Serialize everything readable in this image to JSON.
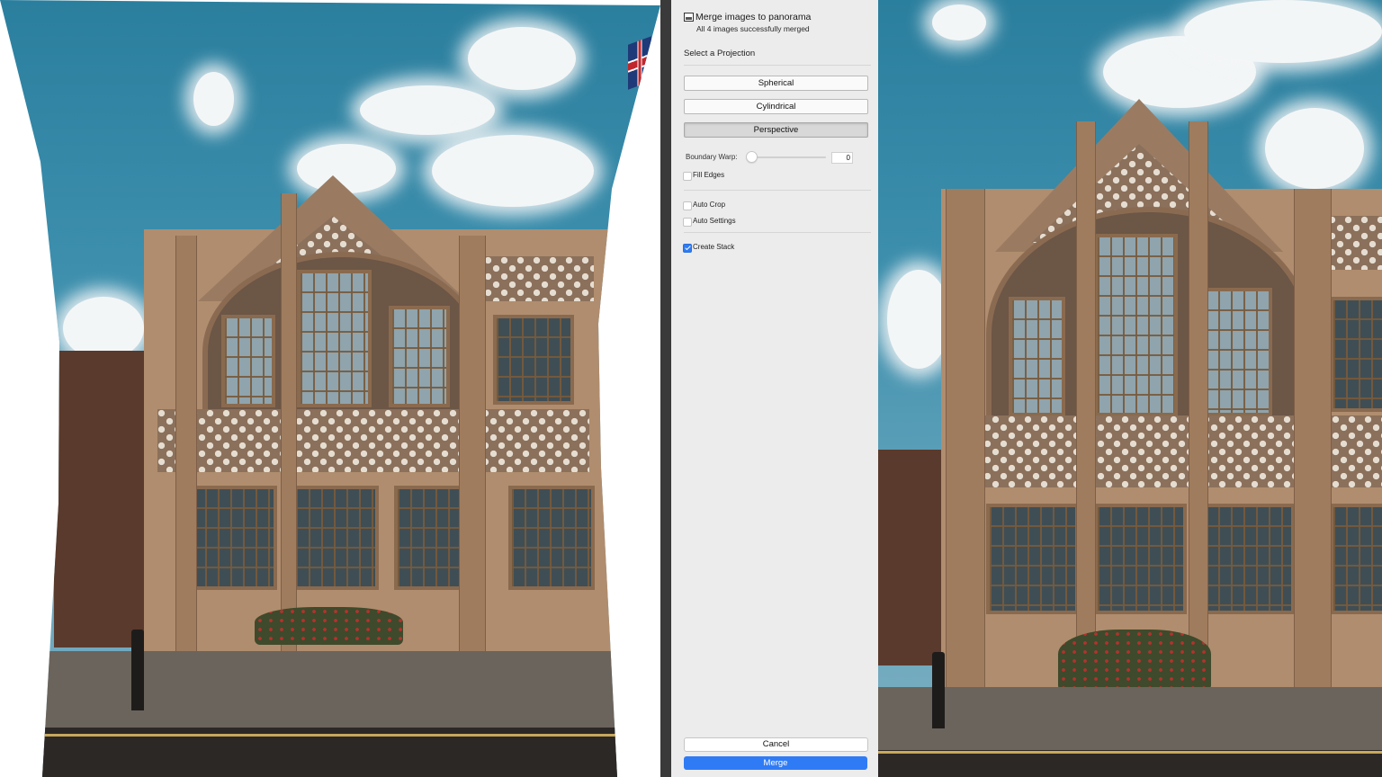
{
  "dialog": {
    "title": "Merge images to panorama",
    "subtitle": "All 4 images successfully merged",
    "icon": "panorama-icon",
    "projection_section_label": "Select a Projection",
    "projections": [
      {
        "label": "Spherical",
        "selected": false
      },
      {
        "label": "Cylindrical",
        "selected": false
      },
      {
        "label": "Perspective",
        "selected": true
      }
    ],
    "boundary_warp": {
      "label": "Boundary Warp:",
      "value": "0"
    },
    "options": {
      "fill_edges": {
        "label": "Fill Edges",
        "checked": false
      },
      "auto_crop": {
        "label": "Auto Crop",
        "checked": false
      },
      "auto_settings": {
        "label": "Auto Settings",
        "checked": false
      },
      "create_stack": {
        "label": "Create Stack",
        "checked": true
      }
    },
    "cancel_label": "Cancel",
    "merge_label": "Merge",
    "accent_color": "#2f7bf5"
  }
}
